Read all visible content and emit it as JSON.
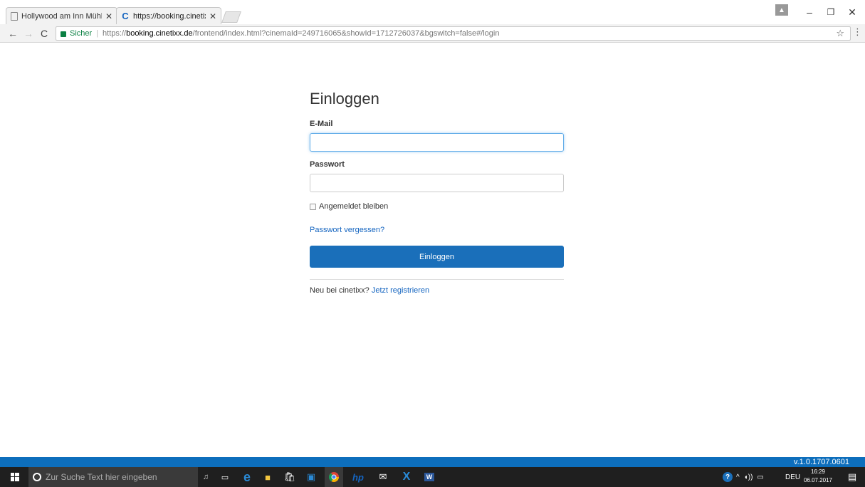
{
  "browser": {
    "tabs": [
      {
        "title": "Hollywood am Inn Mühl",
        "active": false
      },
      {
        "title": "https://booking.cinetixx.c",
        "active": true
      }
    ],
    "omnibox": {
      "secure_label": "Sicher",
      "url_scheme": "https://",
      "url_host": "booking.cinetixx.de",
      "url_rest": "/frontend/index.html?cinemaId=249716065&showId=1712726037&bgswitch=false#/login"
    }
  },
  "login": {
    "heading": "Einloggen",
    "email_label": "E-Mail",
    "email_value": "",
    "password_label": "Passwort",
    "password_value": "",
    "remember_label": "Angemeldet bleiben",
    "remember_checked": false,
    "forgot_link": "Passwort vergessen?",
    "submit_label": "Einloggen",
    "signup_prompt": "Neu bei cinetixx?",
    "signup_link": "Jetzt registrieren"
  },
  "footer": {
    "version": "v.1.0.1707.0601"
  },
  "taskbar": {
    "search_placeholder": "Zur Suche Text hier eingeben",
    "language": "DEU",
    "time": "16:29",
    "date": "06.07.2017"
  },
  "colors": {
    "accent": "#1a6fba",
    "version_bar": "#0d6ebc",
    "link": "#1565c0",
    "secure": "#0b8043"
  }
}
